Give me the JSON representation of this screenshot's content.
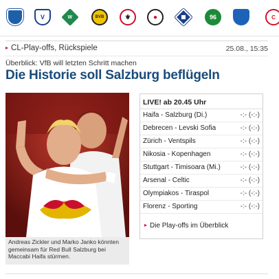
{
  "club_crests": [
    {
      "icon": "hertha-crest-icon",
      "abbr": "",
      "color": "#1f5fa8"
    },
    {
      "icon": "bochum-crest-icon",
      "abbr": "",
      "color": "#1b3f8f"
    },
    {
      "icon": "werder-crest-icon",
      "abbr": "",
      "color": "#1f8a4c"
    },
    {
      "icon": "dortmund-crest-icon",
      "abbr": "",
      "color": "#f2c300"
    },
    {
      "icon": "frankfurt-crest-icon",
      "abbr": "",
      "color": "#c8102e"
    },
    {
      "icon": "freiburg-crest-icon",
      "abbr": "",
      "color": "#222222"
    },
    {
      "icon": "hamburg-crest-icon",
      "abbr": "",
      "color": "#1d3f8a"
    },
    {
      "icon": "hannover-crest-icon",
      "abbr": "96",
      "color": "#1d8a3a"
    },
    {
      "icon": "hoffenheim-crest-icon",
      "abbr": "",
      "color": "#1c63b7"
    },
    {
      "icon": "koeln-crest-icon",
      "abbr": "",
      "color": "#d4122a"
    }
  ],
  "section": {
    "title": "CL-Play-offs, Rückspiele",
    "datetime": "25.08., 15:35"
  },
  "article": {
    "kicker": "Überblick: VfB will letzten Schritt machen",
    "headline": "Die Historie soll Salzburg beflügeln",
    "caption": "Andreas Zickler und Marko Janko könnten gemeinsam für Red Bull Salzburg bei Maccabi Haifa stürmen."
  },
  "live": {
    "header": "LIVE! ab 20.45 Uhr",
    "fixtures": [
      {
        "match": "Haifa - Salzburg (Di.)",
        "score": "-:- (-:-)"
      },
      {
        "match": "Debrecen - Levski Sofia",
        "score": "-:- (-:-)"
      },
      {
        "match": "Zürich - Ventspils",
        "score": "-:- (-:-)"
      },
      {
        "match": "Nikosia - Kopenhagen",
        "score": "-:- (-:-)"
      },
      {
        "match": "Stuttgart - Timisoara (Mi.)",
        "score": "-:- (-:-)"
      },
      {
        "match": "Arsenal - Celtic",
        "score": "-:- (-:-)"
      },
      {
        "match": "Olympiakos - Tiraspol",
        "score": "-:- (-:-)"
      },
      {
        "match": "Florenz - Sporting",
        "score": "-:- (-:-)"
      }
    ],
    "more_link": "Die Play-offs im Überblick"
  },
  "colors": {
    "headline": "#1a4b7a",
    "accent_arrow": "#c8102e",
    "caption_bg": "#ebebeb"
  }
}
